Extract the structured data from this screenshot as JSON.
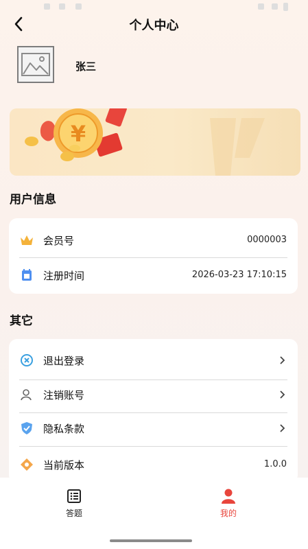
{
  "nav": {
    "title": "个人中心"
  },
  "profile": {
    "username": "张三"
  },
  "user_info": {
    "title": "用户信息",
    "items": [
      {
        "label": "会员号",
        "value": "0000003",
        "icon": "crown-icon"
      },
      {
        "label": "注册时间",
        "value": "2026-03-23 17:10:15",
        "icon": "calendar-icon"
      }
    ]
  },
  "other": {
    "title": "其它",
    "items": [
      {
        "label": "退出登录",
        "icon": "logout-icon"
      },
      {
        "label": "注销账号",
        "icon": "account-cancel-icon"
      },
      {
        "label": "隐私条款",
        "icon": "privacy-shield-icon"
      },
      {
        "label": "当前版本",
        "value": "1.0.0",
        "icon": "version-icon"
      }
    ]
  },
  "tabbar": {
    "items": [
      {
        "label": "答题",
        "icon": "quiz-icon",
        "active": false
      },
      {
        "label": "我的",
        "icon": "profile-icon",
        "active": true
      }
    ]
  },
  "colors": {
    "accent": "#e8453c",
    "banner": "#fae8c6"
  }
}
